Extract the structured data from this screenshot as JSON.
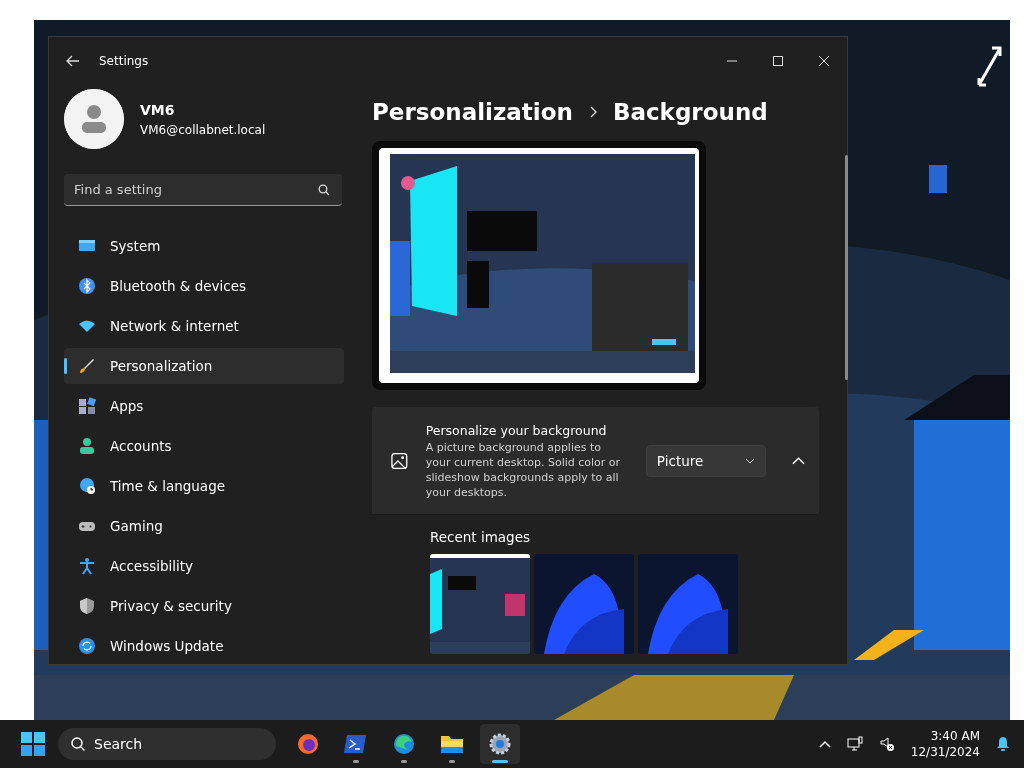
{
  "window": {
    "title": "Settings"
  },
  "user": {
    "name": "VM6",
    "email": "VM6@collabnet.local"
  },
  "search": {
    "placeholder": "Find a setting"
  },
  "nav": [
    {
      "label": "System",
      "selected": false
    },
    {
      "label": "Bluetooth & devices",
      "selected": false
    },
    {
      "label": "Network & internet",
      "selected": false
    },
    {
      "label": "Personalization",
      "selected": true
    },
    {
      "label": "Apps",
      "selected": false
    },
    {
      "label": "Accounts",
      "selected": false
    },
    {
      "label": "Time & language",
      "selected": false
    },
    {
      "label": "Gaming",
      "selected": false
    },
    {
      "label": "Accessibility",
      "selected": false
    },
    {
      "label": "Privacy & security",
      "selected": false
    },
    {
      "label": "Windows Update",
      "selected": false
    }
  ],
  "breadcrumb": [
    "Personalization",
    "Background"
  ],
  "background_setting": {
    "title": "Personalize your background",
    "description": "A picture background applies to your current desktop. Solid color or slideshow backgrounds apply to all your desktops.",
    "dropdown": "Picture",
    "expanded": true
  },
  "recent_images": {
    "label": "Recent images"
  },
  "taskbar": {
    "search_placeholder": "Search",
    "apps": [
      {
        "running": false,
        "selected": false
      },
      {
        "running": true,
        "selected": false
      },
      {
        "running": true,
        "selected": false
      },
      {
        "running": true,
        "selected": false
      },
      {
        "running": true,
        "selected": true
      }
    ],
    "time": "3:40 AM",
    "date": "12/31/2024"
  }
}
